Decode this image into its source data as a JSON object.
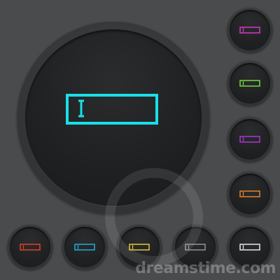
{
  "background_color": "#4a4b4c",
  "main_button": {
    "icon": "text-field-cursor-icon",
    "color": "#17e0ea"
  },
  "side_buttons": [
    {
      "icon": "text-field-cursor-icon",
      "color": "#e23ad8"
    },
    {
      "icon": "text-field-cursor-icon",
      "color": "#7fe14a"
    },
    {
      "icon": "text-field-cursor-icon",
      "color": "#b436e0"
    },
    {
      "icon": "text-field-cursor-icon",
      "color": "#f08a2a"
    }
  ],
  "bottom_buttons": [
    {
      "icon": "text-field-cursor-icon",
      "color": "#f0402a"
    },
    {
      "icon": "text-field-cursor-icon",
      "color": "#1fb8e8"
    },
    {
      "icon": "text-field-cursor-icon",
      "color": "#f2d23a"
    },
    {
      "icon": "text-field-cursor-icon",
      "color": "#9a9a9a"
    },
    {
      "icon": "text-field-cursor-icon",
      "color": "#f4f4f4"
    }
  ],
  "watermark": {
    "text": "dreamstime.com"
  }
}
